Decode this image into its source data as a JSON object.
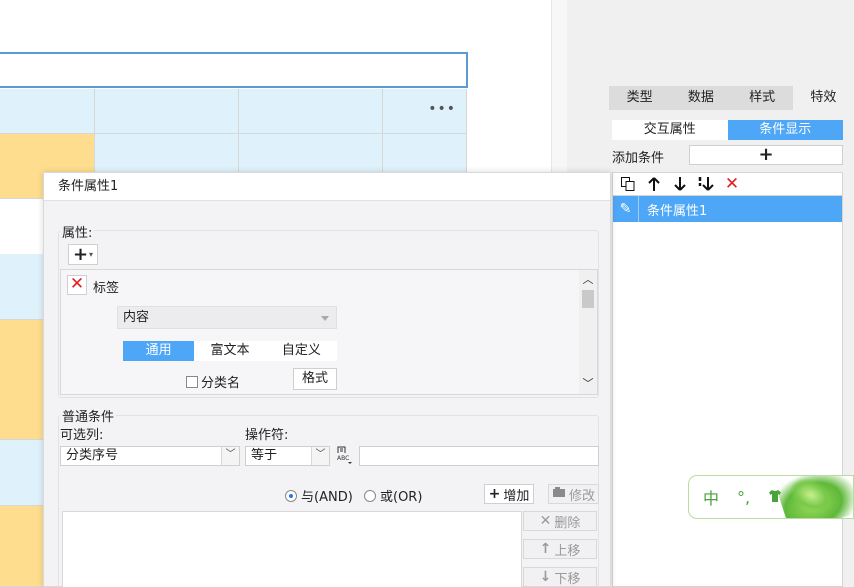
{
  "canvas": {
    "more_menu_glyph": "•••"
  },
  "right_panel": {
    "tabs": [
      "类型",
      "数据",
      "样式",
      "特效"
    ],
    "active_tab": 3,
    "subtabs": [
      "交互属性",
      "条件显示"
    ],
    "add_condition_label": "添加条件",
    "add_condition_button": "+",
    "toolbar_icons": [
      "copy-icon",
      "arrow-up-icon",
      "arrow-down-icon",
      "sort-down-icon",
      "delete-icon"
    ],
    "condition_items": [
      {
        "label": "条件属性1"
      }
    ]
  },
  "ime": {
    "mode": "中",
    "punct": "°,",
    "icon": "shirt-icon"
  },
  "dialog": {
    "title": "条件属性1",
    "attributes": {
      "label": "属性:",
      "add_button": "+",
      "item_name": "标签",
      "content_select": "内容",
      "segments": [
        "通用",
        "富文本",
        "自定义"
      ],
      "active_segment": 0,
      "checkbox_label": "分类名",
      "format_button": "格式"
    },
    "common_condition": {
      "label": "普通条件",
      "column_label": "可选列:",
      "column_value": "分类序号",
      "operator_label": "操作符:",
      "operator_value": "等于",
      "value_input": "",
      "radio_and": "与(AND)",
      "radio_or": "或(OR)",
      "add_button": "增加",
      "modify_button": "修改",
      "delete_button": "删除",
      "move_up_button": "上移",
      "move_down_button": "下移"
    }
  },
  "colors": {
    "accent": "#4ea6f7",
    "selection_border": "#5b9bd5",
    "cell_light": "#dff1fb",
    "cell_yellow": "#fedd8f",
    "danger": "#e02020"
  }
}
